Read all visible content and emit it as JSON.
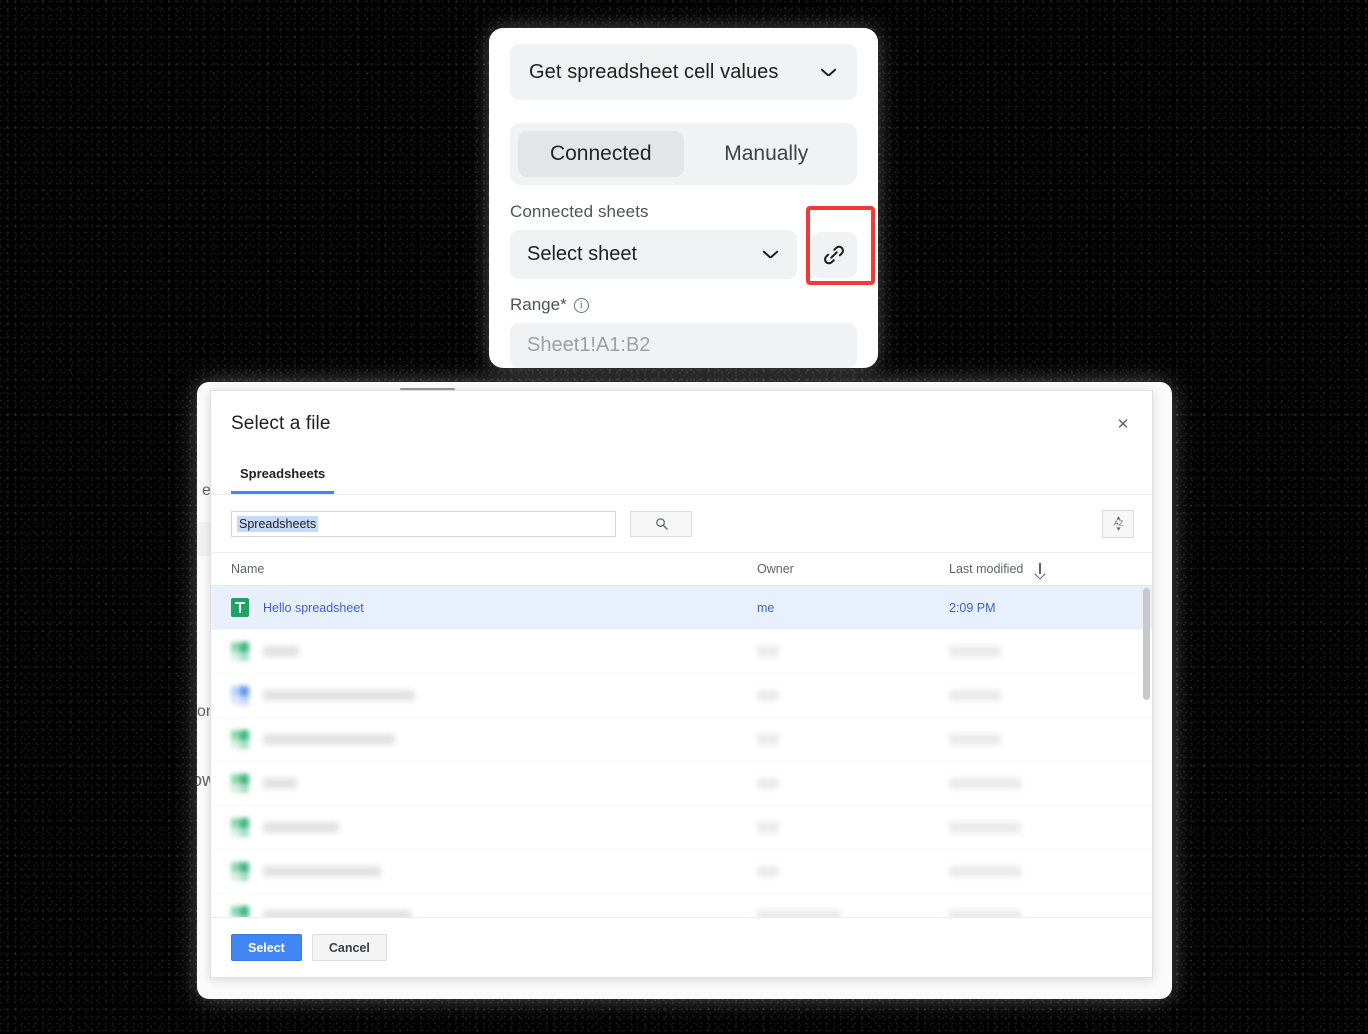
{
  "panel": {
    "action_label": "Get spreadsheet cell values",
    "chevron_icon": "chevron-down-icon",
    "tabs": [
      {
        "label": "Connected",
        "active": true
      },
      {
        "label": "Manually",
        "active": false
      }
    ],
    "connected_sheets_label": "Connected sheets",
    "sheet_select_value": "Select sheet",
    "link_icon": "link-icon",
    "range_label": "Range*",
    "range_info_icon": "info-circle-icon",
    "range_placeholder": "Sheet1!A1:B2",
    "highlight_color": "#ef3b36"
  },
  "background_fragments": [
    {
      "text": "et c"
    },
    {
      "text": "onc"
    },
    {
      "text": "ow"
    }
  ],
  "dialog": {
    "title": "Select a file",
    "close_icon": "close-icon",
    "tabs": [
      {
        "label": "Spreadsheets",
        "active": true
      }
    ],
    "search": {
      "value": "Spreadsheets",
      "placeholder": "",
      "search_icon": "search-icon",
      "sort_icon": "sort-az-icon"
    },
    "table": {
      "columns": [
        "Name",
        "Owner",
        "Last modified"
      ],
      "sort_column": "Last modified",
      "sort_direction_icon": "arrow-down-icon",
      "rows": [
        {
          "name": "Hello spreadsheet",
          "owner": "me",
          "modified": "2:09 PM",
          "icon": "google-sheets-icon",
          "selected": true,
          "redacted": false
        },
        {
          "name": "",
          "owner": "",
          "modified": "",
          "icon": "google-sheets-icon",
          "selected": false,
          "redacted": true,
          "icon_color": "green",
          "name_w": 36,
          "owner_w": 22,
          "mod_w": 52
        },
        {
          "name": "",
          "owner": "",
          "modified": "",
          "icon": "google-docs-icon",
          "selected": false,
          "redacted": true,
          "icon_color": "blue",
          "name_w": 152,
          "owner_w": 22,
          "mod_w": 52
        },
        {
          "name": "",
          "owner": "",
          "modified": "",
          "icon": "google-sheets-icon",
          "selected": false,
          "redacted": true,
          "icon_color": "green",
          "name_w": 132,
          "owner_w": 22,
          "mod_w": 52
        },
        {
          "name": "",
          "owner": "",
          "modified": "",
          "icon": "google-sheets-icon",
          "selected": false,
          "redacted": true,
          "icon_color": "green",
          "name_w": 34,
          "owner_w": 22,
          "mod_w": 72
        },
        {
          "name": "",
          "owner": "",
          "modified": "",
          "icon": "google-sheets-icon",
          "selected": false,
          "redacted": true,
          "icon_color": "green",
          "name_w": 76,
          "owner_w": 22,
          "mod_w": 72
        },
        {
          "name": "",
          "owner": "",
          "modified": "",
          "icon": "google-sheets-icon",
          "selected": false,
          "redacted": true,
          "icon_color": "green",
          "name_w": 118,
          "owner_w": 22,
          "mod_w": 72
        },
        {
          "name": "",
          "owner": "",
          "modified": "",
          "icon": "google-sheets-icon",
          "selected": false,
          "redacted": true,
          "icon_color": "green",
          "name_w": 148,
          "owner_w": 84,
          "mod_w": 72
        }
      ]
    },
    "footer": {
      "select_label": "Select",
      "cancel_label": "Cancel"
    },
    "scrollbar": {
      "visible": true
    }
  }
}
